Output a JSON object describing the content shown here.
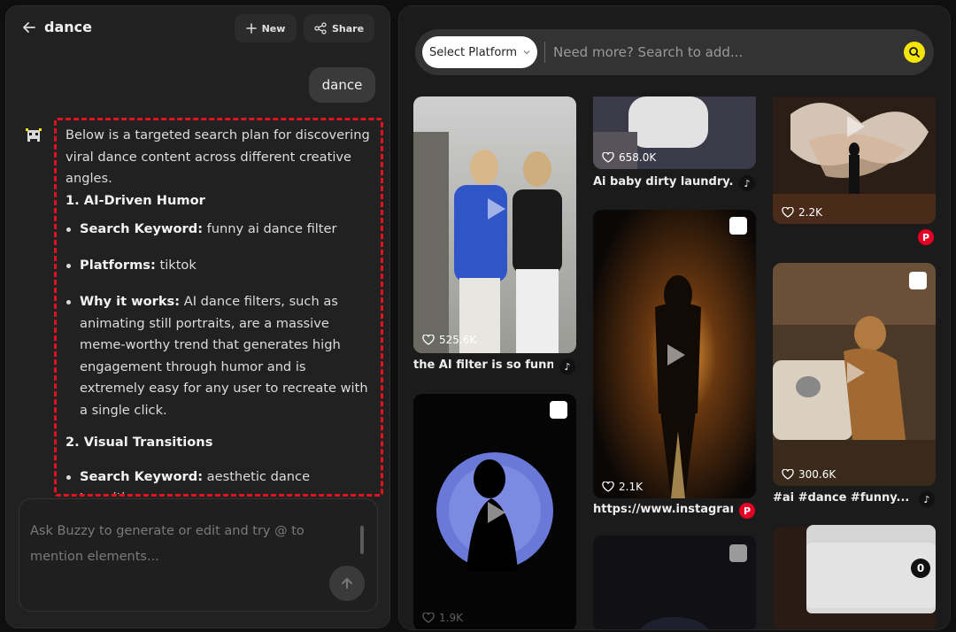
{
  "header": {
    "title": "dance",
    "new_label": "New",
    "share_label": "Share"
  },
  "chat": {
    "user_message": "dance",
    "answer": {
      "intro": "Below is a targeted search plan for discovering viral dance content across different creative angles.",
      "section1_title": "1. AI-Driven Humor",
      "s1_kw_label": "Search Keyword:",
      "s1_kw_value": " funny ai dance filter",
      "s1_pf_label": "Platforms:",
      "s1_pf_value": " tiktok",
      "s1_why_label": "Why it works:",
      "s1_why_value": " AI dance filters, such as animating still portraits, are a massive meme-worthy trend that generates high engagement through humor and is extremely easy for any user to recreate with a single click.",
      "section2_title": "2. Visual Transitions",
      "s2_kw_label": "Search Keyword:",
      "s2_kw_value": " aesthetic dance transition"
    },
    "composer_placeholder": "Ask Buzzy to generate or edit and try @ to mention elements..."
  },
  "search": {
    "platform_label": "Select Platform",
    "placeholder": "Need more? Search to add..."
  },
  "results": [
    {
      "likes": "525.6K",
      "caption": "the AI filter is so funny...",
      "platform": "tiktok"
    },
    {
      "likes": "658.0K",
      "caption": "Ai baby dirty laundry...",
      "platform": "tiktok"
    },
    {
      "likes": "2.2K",
      "caption": "",
      "platform": "pinterest"
    },
    {
      "likes": "2.1K",
      "caption": "https://www.instagram.",
      "platform": "pinterest"
    },
    {
      "likes": "300.6K",
      "caption": "#ai #dance #funny...",
      "platform": "tiktok"
    },
    {
      "likes": "1.9K",
      "caption": "",
      "platform": ""
    }
  ],
  "collection": {
    "count": "0"
  },
  "colors": {
    "accent_yellow": "#f5e40a",
    "highlight_red": "#e0141e",
    "pinterest_red": "#e60023"
  }
}
